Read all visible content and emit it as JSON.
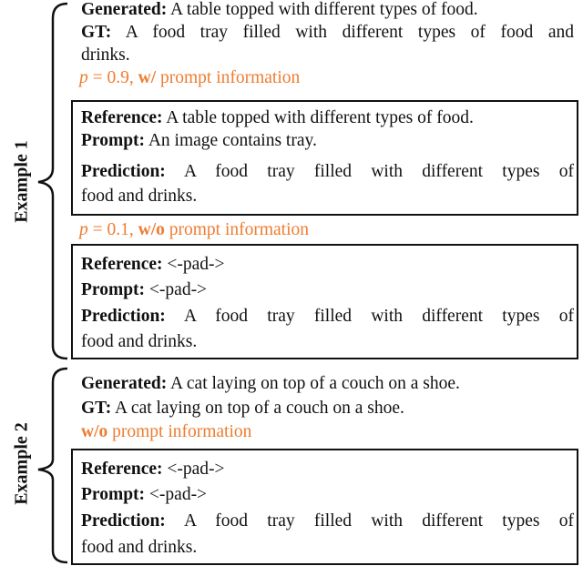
{
  "example1": {
    "label": "Example 1",
    "generated": {
      "key": "Generated:",
      "text": " A table topped with different types of food."
    },
    "gt": {
      "key": "GT:",
      "text": " A food tray filled with different types of food and",
      "text2": "drinks."
    },
    "case_a": {
      "p_var": "p",
      "p_eq": " = 0.9, ",
      "mode": "w/",
      "suffix": " prompt information",
      "reference": {
        "key": "Reference:",
        "text": " A table topped with different types of food."
      },
      "prompt": {
        "key": "Prompt:",
        "text": " An image contains tray."
      },
      "prediction": {
        "key": "Prediction:",
        "text": " A food tray filled with different types of",
        "text2": "food and drinks."
      }
    },
    "case_b": {
      "p_var": "p",
      "p_eq": " = 0.1, ",
      "mode": "w/o",
      "suffix": " prompt information",
      "reference": {
        "key": "Reference:",
        "text": " <-pad->"
      },
      "prompt": {
        "key": "Prompt:",
        "text": " <-pad->"
      },
      "prediction": {
        "key": "Prediction:",
        "text": " A food tray filled with different types of",
        "text2": "food and drinks."
      }
    }
  },
  "example2": {
    "label": "Example 2",
    "generated": {
      "key": "Generated:",
      "text": " A cat laying on top of a couch on a shoe."
    },
    "gt": {
      "key": "GT:",
      "text": " A cat laying on top of a couch on a shoe."
    },
    "case_a": {
      "mode": "w/o",
      "suffix": " prompt information",
      "reference": {
        "key": "Reference:",
        "text": " <-pad->"
      },
      "prompt": {
        "key": "Prompt:",
        "text": " <-pad->"
      },
      "prediction": {
        "key": "Prediction:",
        "text": " A food tray filled with different types of",
        "text2": "food and drinks."
      }
    }
  },
  "colors": {
    "accent": "#ee7c30",
    "text": "#111111"
  }
}
